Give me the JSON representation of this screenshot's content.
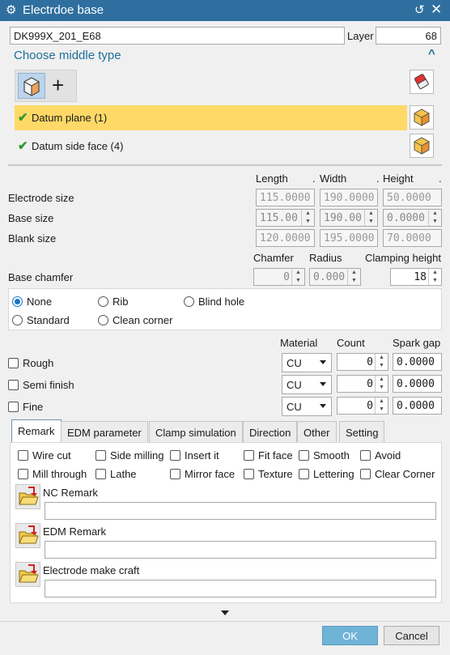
{
  "window": {
    "title": "Electrdoe base"
  },
  "top": {
    "name_value": "DK999X_201_E68",
    "layer_label": "Layer",
    "layer_value": "68"
  },
  "middle": {
    "heading": "Choose middle type",
    "items": [
      {
        "label": "Datum plane (1)",
        "selected": true
      },
      {
        "label": "Datum side face (4)",
        "selected": false
      }
    ]
  },
  "size": {
    "headers": [
      "Length",
      ".",
      "Width",
      ".",
      "Height",
      "."
    ],
    "rows": [
      {
        "label": "Electrode size",
        "values": [
          "115.0000",
          "190.0000",
          "50.0000"
        ]
      },
      {
        "label": "Base size",
        "values": [
          "115.00",
          "190.00",
          "0.0000"
        ]
      },
      {
        "label": "Blank size",
        "values": [
          "120.0000",
          "195.0000",
          "70.0000"
        ]
      }
    ]
  },
  "chamfer": {
    "headers": [
      "Chamfer",
      "Radius",
      "Clamping height"
    ],
    "label": "Base chamfer",
    "values": [
      "0",
      "0.000",
      "18"
    ]
  },
  "chamfer_type": {
    "options": [
      "None",
      "Rib",
      "Blind hole",
      "Standard",
      "Clean corner"
    ],
    "selected": "None"
  },
  "finish": {
    "headers": [
      "Material",
      "Count",
      "Spark gap"
    ],
    "rows": [
      {
        "label": "Rough",
        "material": "CU",
        "count": "0",
        "gap": "0.0000"
      },
      {
        "label": "Semi finish",
        "material": "CU",
        "count": "0",
        "gap": "0.0000"
      },
      {
        "label": "Fine",
        "material": "CU",
        "count": "0",
        "gap": "0.0000"
      }
    ]
  },
  "tabs": [
    "Remark",
    "EDM parameter",
    "Clamp simulation",
    "Direction",
    "Other",
    "Setting"
  ],
  "remark": {
    "checks": [
      "Wire cut",
      "Side milling",
      "Insert it",
      "Fit face",
      "Smooth",
      "Avoid",
      "Mill through",
      "Lathe",
      "Mirror face",
      "Texture",
      "Lettering",
      "Clear Corner"
    ],
    "fields": [
      "NC Remark",
      "EDM Remark",
      "Electrode make craft"
    ]
  },
  "buttons": {
    "ok": "OK",
    "cancel": "Cancel"
  },
  "colors": {
    "titlebar": "#2f6f9f",
    "highlight": "#ffd968",
    "ok": "#6fb3d6",
    "heading": "#1f6f99"
  },
  "icons": {
    "title": "gear-icon",
    "reset": "refresh-icon",
    "close": "close-icon",
    "collapse": "chevron-up-icon",
    "more": "triangle-down-icon"
  }
}
